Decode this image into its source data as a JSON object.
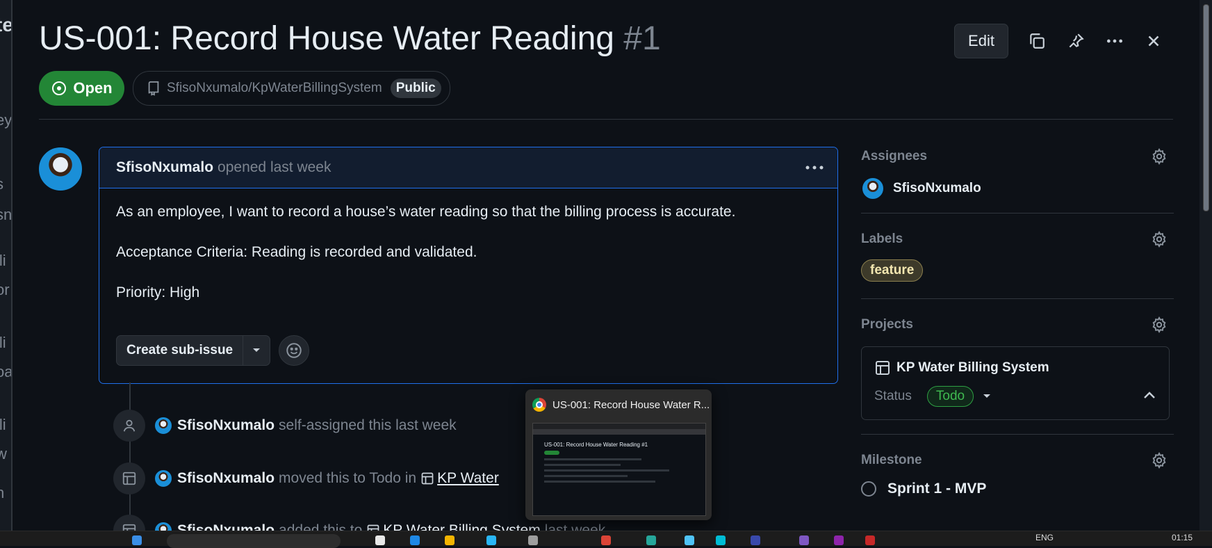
{
  "issue": {
    "title": "US-001: Record House Water Reading",
    "number": "#1",
    "state": "Open",
    "repo": "SfisoNxumalo/KpWaterBillingSystem",
    "visibility": "Public"
  },
  "header_actions": {
    "edit_label": "Edit"
  },
  "comment": {
    "author": "SfisoNxumalo",
    "meta": "opened last week",
    "body": [
      "As an employee, I want to record a house’s water reading so that the billing process is accurate.",
      "Acceptance Criteria: Reading is recorded and validated.",
      "Priority: High"
    ],
    "create_subissue_label": "Create sub-issue"
  },
  "timeline": [
    {
      "who": "SfisoNxumalo",
      "text": "self-assigned this last week"
    },
    {
      "who": "SfisoNxumalo",
      "text": "moved this to Todo in",
      "project": "KP Water"
    },
    {
      "who": "SfisoNxumalo",
      "text": "added this to",
      "project": "KP Water Billing System",
      "suffix": "last week"
    }
  ],
  "sidebar": {
    "assignees": {
      "title": "Assignees",
      "user": "SfisoNxumalo"
    },
    "labels": {
      "title": "Labels",
      "label": "feature"
    },
    "projects": {
      "title": "Projects",
      "project_name": "KP Water Billing System",
      "status_label": "Status",
      "status_value": "Todo"
    },
    "milestone": {
      "title": "Milestone",
      "value": "Sprint 1 - MVP"
    }
  },
  "taskbar_popup": {
    "title": "US-001: Record House Water R...",
    "thumb_title": "US-001: Record House Water Reading #1"
  },
  "background_fragments": [
    "te",
    "ey",
    "s",
    "sn",
    "lli",
    "or",
    "lli",
    "oa",
    "lli",
    "w",
    "n"
  ],
  "tray": {
    "lang": "ENG",
    "time": "01:15"
  },
  "colors": {
    "accent_blue": "#1f6feb",
    "open_green": "#238636",
    "bg": "#0d1117"
  }
}
